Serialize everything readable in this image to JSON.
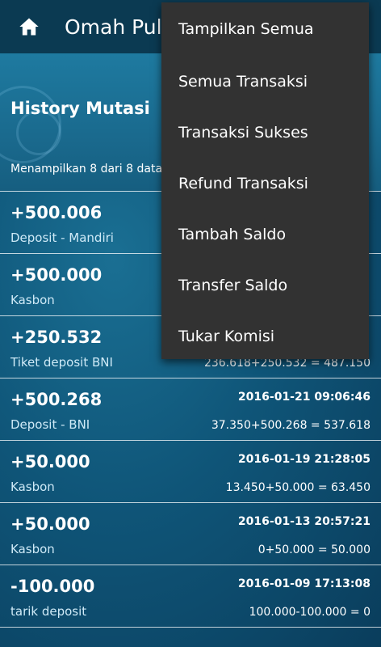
{
  "app": {
    "title": "Omah Pulsa",
    "home_icon": "home-icon"
  },
  "page": {
    "title": "History Mutasi",
    "summary": "Menampilkan 8 dari 8 data"
  },
  "transactions": [
    {
      "amount": "+500.006",
      "desc": "Deposit - Mandiri",
      "date": "",
      "calc": ""
    },
    {
      "amount": "+500.000",
      "desc": "Kasbon",
      "date": "",
      "calc": ""
    },
    {
      "amount": "+250.532",
      "desc": "Tiket deposit BNI",
      "date": "",
      "calc": "236.618+250.532 = 487.150"
    },
    {
      "amount": "+500.268",
      "desc": "Deposit - BNI",
      "date": "2016-01-21 09:06:46",
      "calc": "37.350+500.268 = 537.618"
    },
    {
      "amount": "+50.000",
      "desc": "Kasbon",
      "date": "2016-01-19 21:28:05",
      "calc": "13.450+50.000 = 63.450"
    },
    {
      "amount": "+50.000",
      "desc": "Kasbon",
      "date": "2016-01-13 20:57:21",
      "calc": "0+50.000 = 50.000"
    },
    {
      "amount": "-100.000",
      "desc": "tarik deposit",
      "date": "2016-01-09 17:13:08",
      "calc": "100.000-100.000 = 0"
    }
  ],
  "menu": {
    "items": [
      "Tampilkan Semua",
      "Semua Transaksi",
      "Transaksi Sukses",
      "Refund Transaksi",
      "Tambah Saldo",
      "Transfer Saldo",
      "Tukar Komisi"
    ]
  },
  "colors": {
    "topbar": "#0b3a52",
    "menu_bg": "#323232",
    "background": "#0f5578"
  }
}
